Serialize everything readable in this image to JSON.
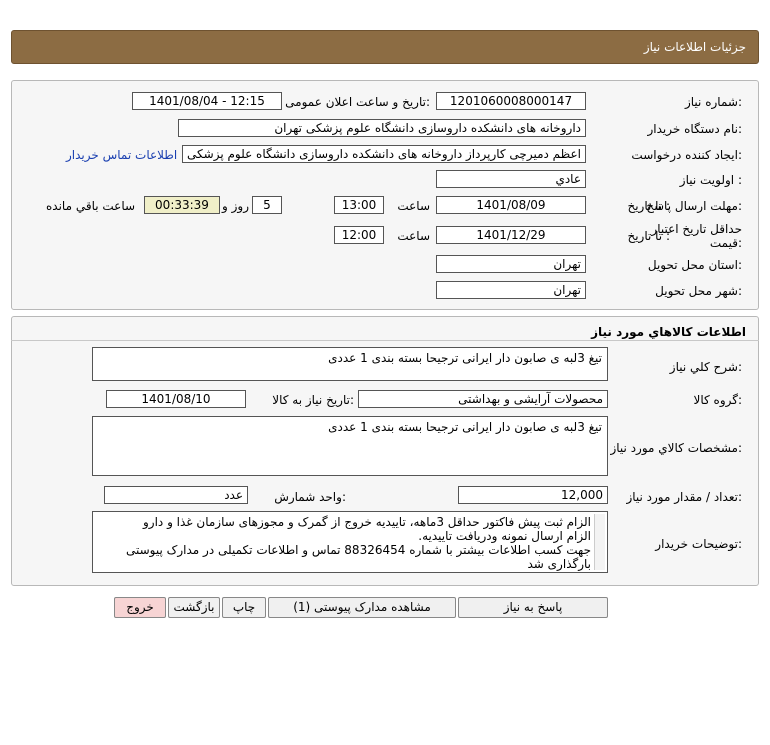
{
  "header": {
    "title": "جزئیات اطلاعات نیاز"
  },
  "form": {
    "need_number": {
      "label": "شماره نیاز:",
      "value": "1201060008000147"
    },
    "announce": {
      "label": "تاریخ و ساعت اعلان عمومی:",
      "value": "1401/08/04 - 12:15"
    },
    "buyer": {
      "label": "نام دستگاه خریدار:",
      "value": "داروخانه های دانشکده داروسازی دانشگاه علوم پزشکی تهران"
    },
    "creator": {
      "label": "ایجاد کننده درخواست:",
      "value": "اعظم دمیرچی کارپرداز داروخانه های دانشکده داروسازی دانشگاه علوم پزشکی تهران",
      "contact_link": "اطلاعات تماس خریدار"
    },
    "priority": {
      "label": "اولویت نیاز :",
      "value": "عادي"
    },
    "deadline": {
      "label": "مهلت ارسال پاسخ:",
      "to_date_label": "تا تاریخ :",
      "date": "1401/08/09",
      "time_label": "ساعت",
      "time": "13:00",
      "days": "5",
      "days_label": "روز و",
      "remaining": "00:33:39",
      "remaining_label": "ساعت باقي مانده"
    },
    "validity": {
      "label": "حداقل تاریخ اعتبار قیمت:",
      "to_date_label": "تا تاریخ :",
      "date": "1401/12/29",
      "time_label": "ساعت",
      "time": "12:00"
    },
    "province": {
      "label": "استان محل تحویل:",
      "value": "تهران"
    },
    "city": {
      "label": "شهر محل تحویل:",
      "value": "تهران"
    }
  },
  "goods": {
    "section_title": "اطلاعات کالاهاي مورد نياز",
    "summary": {
      "label": "شرح کلي نياز:",
      "value": "تیغ 3لبه ی صابون دار ایرانی ترجیحا بسته بندی 1 عددی"
    },
    "group": {
      "label": "گروه کالا:",
      "value": "محصولات آرایشی و بهداشتی",
      "need_date_label": "تاریخ نیاز به کالا:",
      "need_date": "1401/08/10"
    },
    "specs": {
      "label": "مشخصات کالاي مورد نياز:",
      "value": "تیغ 3لبه ی صابون دار ایرانی ترجیحا بسته بندی 1 عددی"
    },
    "quantity": {
      "label": "تعداد / مقدار مورد نیاز:",
      "value": "12,000",
      "unit_label": "واحد شمارش:",
      "unit": "عدد"
    },
    "buyer_notes": {
      "label": "توضیحات خریدار:",
      "lines": [
        "الزام ثبت پیش فاکتور حداقل 3ماهه، تاییدیه خروج از گمرک و مجوزهای سازمان غذا و دارو",
        "الزام ارسال نمونه ودریافت تاییدیه.",
        "جهت کسب اطلاعات بیشتر با شماره 88326454 تماس و اطلاعات تکمیلی در مدارک پیوستی بارگذاری شد"
      ]
    }
  },
  "buttons": {
    "reply": "پاسخ به نیاز",
    "view_docs": "مشاهده مدارک پیوستی (1)",
    "print": "چاپ",
    "back": "بازگشت",
    "exit": "خروج"
  },
  "colors": {
    "header_bg": "#8c6c43",
    "exit_bg": "#f7d4d4",
    "remaining_bg": "#f0efc8"
  }
}
